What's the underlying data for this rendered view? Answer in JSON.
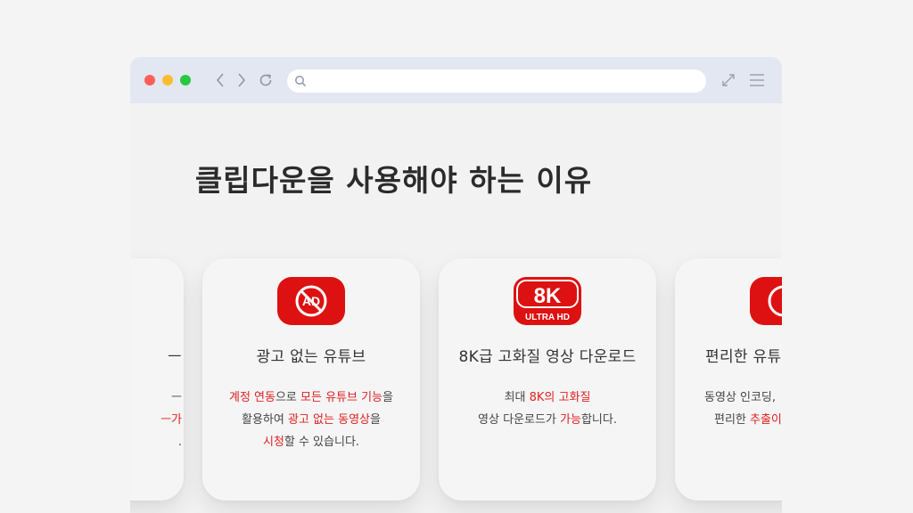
{
  "browser": {
    "url_placeholder": "",
    "icons": [
      "chevron-left-icon",
      "chevron-right-icon",
      "reload-icon",
      "search-icon",
      "expand-icon",
      "menu-icon"
    ]
  },
  "section": {
    "heading": "클립다운을 사용해야 하는 이유"
  },
  "cards": [
    {
      "title": "ㅡ",
      "desc_lines": [
        "ㅡ",
        "ㅡ가",
        "."
      ]
    },
    {
      "title": "광고 없는 유튜브",
      "desc_a1": "계정 연동",
      "desc_a2": "으로 ",
      "desc_a3": "모든 유튜브 기능",
      "desc_a4": "을",
      "desc_b1": "활용하여 ",
      "desc_b2": "광고 없는 동영상",
      "desc_b3": "을",
      "desc_c1": "시청",
      "desc_c2": "할 수 있습니다.",
      "badge_text": "AD"
    },
    {
      "title": "8K급 고화질 영상 다운로드",
      "desc_a1": "최대 ",
      "desc_a2": "8K의 고화질",
      "desc_b1": "영상 다운로드가 ",
      "desc_b2": "가능",
      "desc_b3": "합니다.",
      "badge_big": "8K",
      "badge_small": "ULTRA HD"
    },
    {
      "title": "편리한 유튜",
      "desc_a1": "동영상 인코딩,",
      "desc_b1": "편리한 ",
      "desc_b2": "추출이"
    }
  ],
  "colors": {
    "accent": "#e02020",
    "icon_red": "#dd1111",
    "titlebar": "#e3e7f1"
  }
}
